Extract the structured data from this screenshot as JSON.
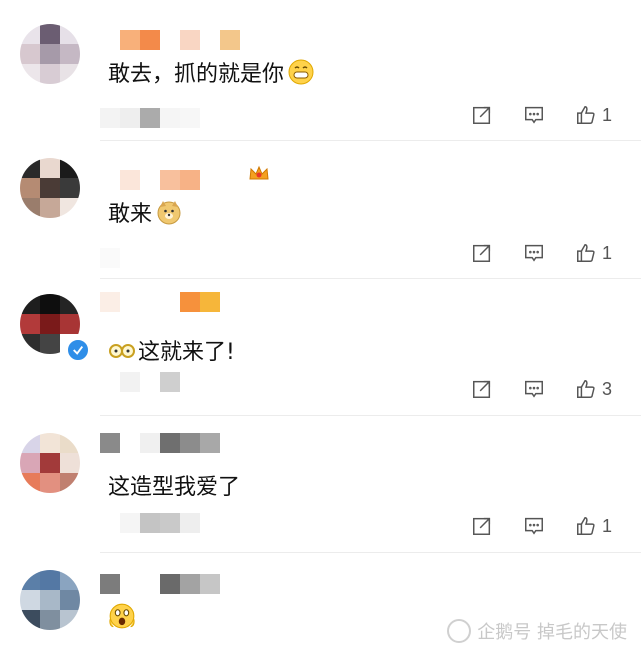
{
  "comments": [
    {
      "text": "敢去，抓的就是你",
      "emoji": "grinning-face-emoji",
      "like_count": "1",
      "avatar_colors": [
        "#e9e3ea",
        "#6b5d72",
        "#e6e0e8",
        "#d7c8cf",
        "#a69aa9",
        "#c5b8c4",
        "#ece6ea",
        "#d8ccd4",
        "#e8e2e6"
      ],
      "name_colors": [
        "#ffffff",
        "#f8b07a",
        "#f38a4a",
        "#ffffff",
        "#f9d6c3",
        "#ffffff",
        "#f3c78b"
      ]
    },
    {
      "text": "敢来",
      "emoji": "doge-emoji",
      "like_count": "1",
      "avatar_colors": [
        "#2a2a2a",
        "#e9d8cf",
        "#1b1b1b",
        "#b58b73",
        "#4a3b36",
        "#3a3a3a",
        "#9a7d6c",
        "#c6a898",
        "#f0e6e0"
      ],
      "name_colors": [
        "#ffffff",
        "#fbe6da",
        "#ffffff",
        "#f8c09d",
        "#f7b286",
        "#ffffff"
      ],
      "badge": "crown-icon"
    },
    {
      "text": "这就来了!",
      "emoji": "glasses-emoji",
      "like_count": "3",
      "avatar_colors": [
        "#1e1e1e",
        "#0e0e0e",
        "#242424",
        "#b23a3a",
        "#7a1a1a",
        "#a83535",
        "#2e2e2e",
        "#444444",
        "#ffffff"
      ],
      "name_colors": [
        "#fbeee6",
        "#ffffff",
        "#ffffff",
        "#ffffff",
        "#f6913c",
        "#f6b63a"
      ],
      "badge": "verified-icon"
    },
    {
      "text": "这造型我爱了",
      "like_count": "1",
      "avatar_colors": [
        "#d8d4e8",
        "#f2e4d7",
        "#eadcc9",
        "#d9a6b6",
        "#a23a3a",
        "#eee0d8",
        "#e77b5a",
        "#e29080",
        "#c08070"
      ],
      "name_colors": [
        "#8a8a8a",
        "#ffffff",
        "#f0f0f0",
        "#6f6f6f",
        "#8c8c8c",
        "#a8a8a8"
      ]
    },
    {
      "emoji": "scream-face-emoji",
      "avatar_colors": [
        "#5b7fa8",
        "#5478a4",
        "#8aa4c0",
        "#cfd8e2",
        "#a8b8c8",
        "#6f88a3",
        "#3c4c5e",
        "#7f8f9f",
        "#b8c4d0"
      ],
      "name_colors": [
        "#7c7c7c",
        "#ffffff",
        "#ffffff",
        "#6a6a6a",
        "#a3a3a3",
        "#c6c6c6"
      ]
    }
  ],
  "watermark": {
    "text": "企鹅号 掉毛的天使"
  }
}
